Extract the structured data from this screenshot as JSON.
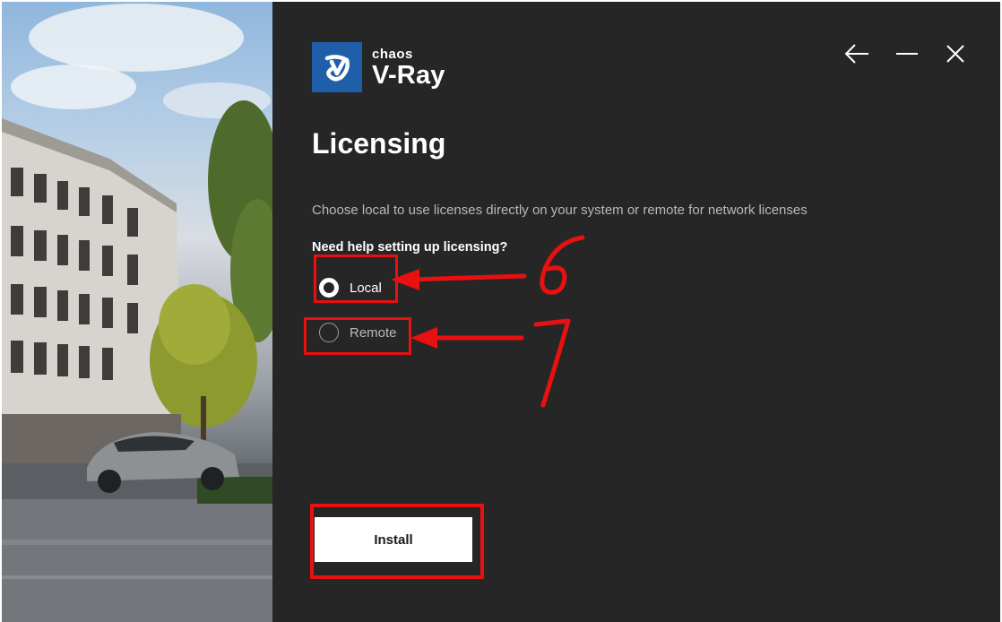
{
  "brand": {
    "small": "chaos",
    "big": "V-Ray",
    "accent": "#1f5ea8"
  },
  "window_controls": {
    "back": "arrow-left-icon",
    "minimize": "minimize-icon",
    "close": "close-icon"
  },
  "page": {
    "title": "Licensing",
    "description": "Choose local to use licenses directly on your system or remote for network licenses",
    "help": "Need help setting up licensing?"
  },
  "options": [
    {
      "label": "Local",
      "selected": true
    },
    {
      "label": "Remote",
      "selected": false
    }
  ],
  "install_label": "Install",
  "annotations": {
    "color": "#e81010",
    "marks": [
      "6",
      "7"
    ]
  }
}
